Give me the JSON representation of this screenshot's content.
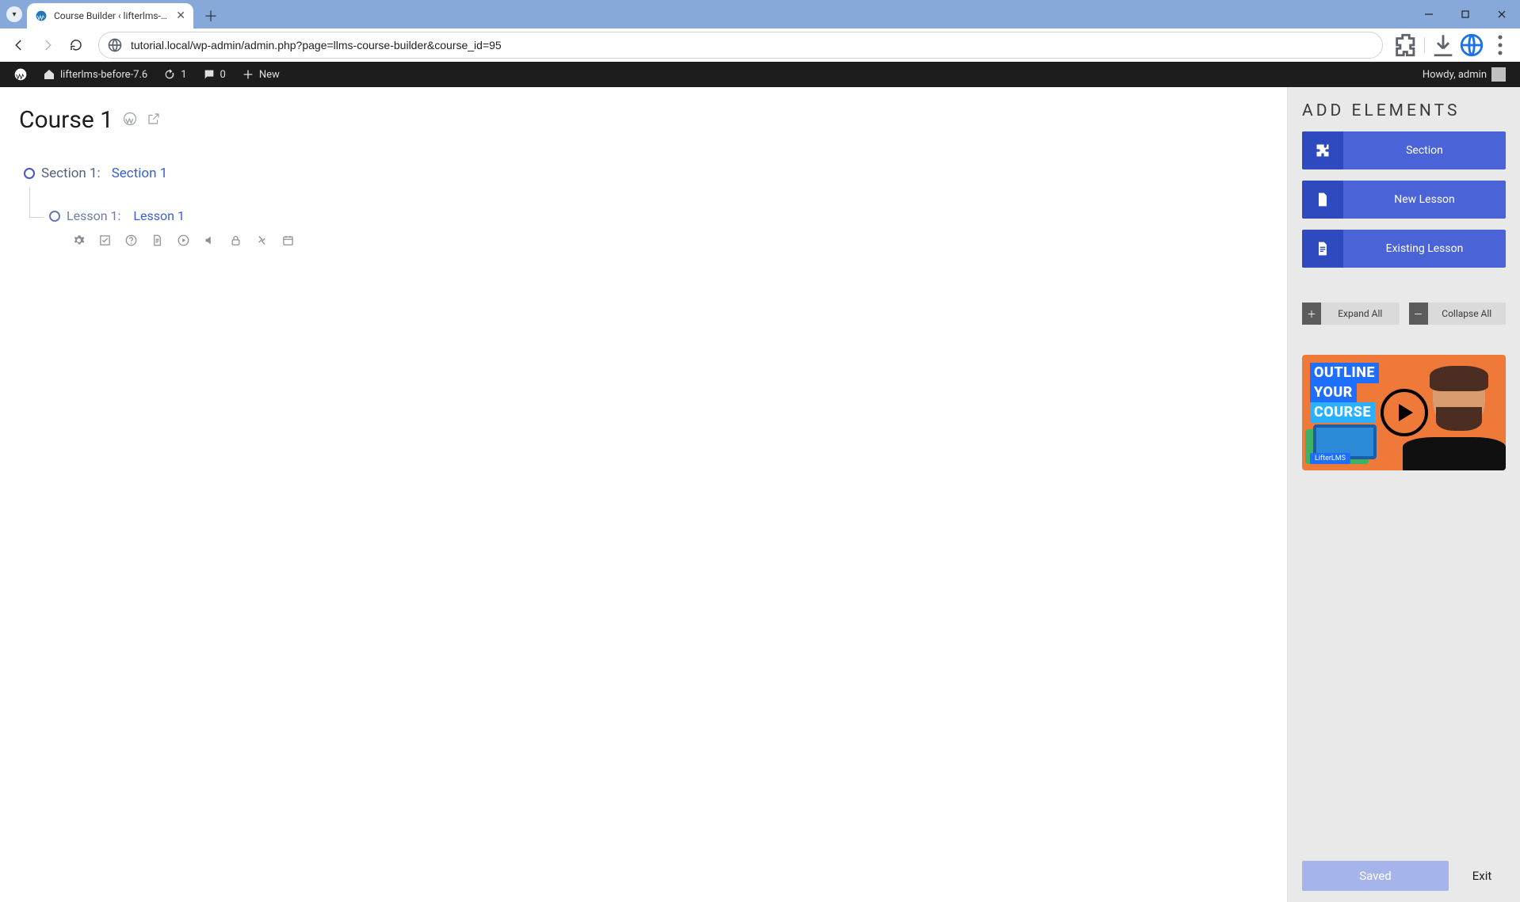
{
  "browser": {
    "tab_title": "Course Builder ‹ lifterlms-befor",
    "url": "tutorial.local/wp-admin/admin.php?page=llms-course-builder&course_id=95"
  },
  "wp_admin_bar": {
    "site_name": "lifterlms-before-7.6",
    "updates_count": "1",
    "comments_count": "0",
    "new_label": "New",
    "howdy": "Howdy, admin"
  },
  "course": {
    "title": "Course 1",
    "section": {
      "prefix": "Section 1:",
      "name": "Section 1"
    },
    "lesson": {
      "prefix": "Lesson 1:",
      "name": "Lesson 1"
    },
    "lesson_tool_icons": [
      "settings-icon",
      "checkmark-icon",
      "question-icon",
      "file-icon",
      "play-circle-icon",
      "audio-icon",
      "lock-icon",
      "prereq-icon",
      "calendar-icon"
    ]
  },
  "sidebar": {
    "heading": "ADD ELEMENTS",
    "buttons": {
      "section": "Section",
      "new_lesson": "New Lesson",
      "existing_lesson": "Existing Lesson"
    },
    "expand_label": "Expand All",
    "collapse_label": "Collapse All",
    "video": {
      "line1": "OUTLINE",
      "line2": "YOUR",
      "line3": "COURSE",
      "badge": "LifterLMS"
    },
    "saved_label": "Saved",
    "exit_label": "Exit"
  }
}
